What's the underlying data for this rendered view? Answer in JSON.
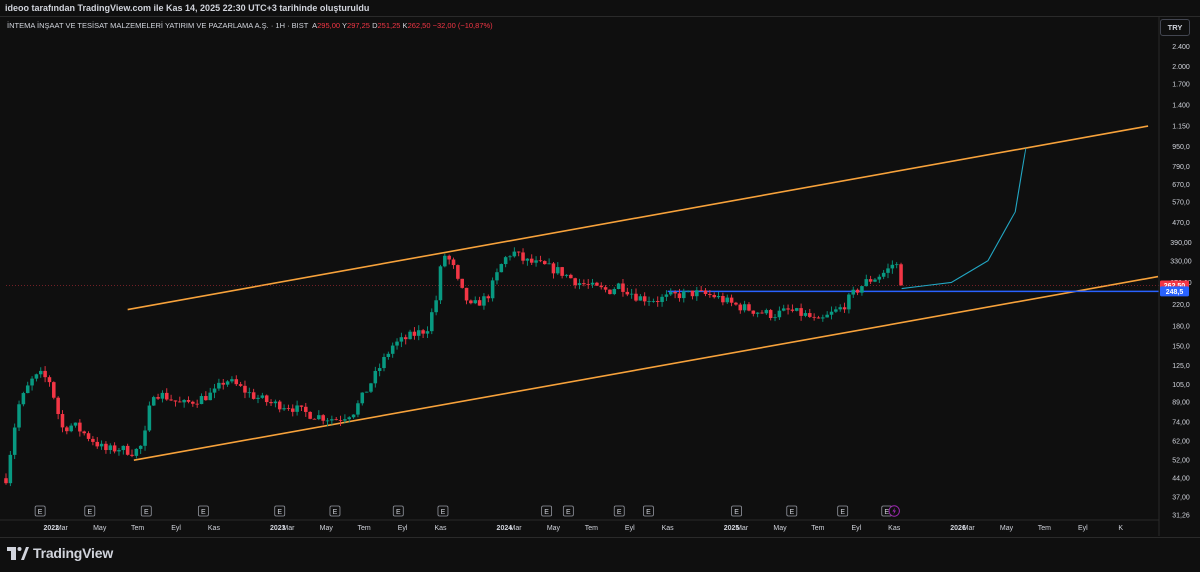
{
  "header": {
    "credit": "ideoo tarafından TradingView.com ile Kas 14, 2025 22:30 UTC+3 tarihinde oluşturuldu"
  },
  "legend": {
    "symbol": "İNTEMA İNŞAAT VE TESİSAT MALZEMELERİ YATIRIM VE PAZARLAMA A.Ş. · 1H · BIST",
    "open_label": "A",
    "open": "295,00",
    "high_label": "Y",
    "high": "297,25",
    "low_label": "D",
    "low": "251,25",
    "close_label": "K",
    "close": "262,50",
    "change": "−32,00 (−10,87%)"
  },
  "currency_button": "TRY",
  "footer": {
    "brand": "TradingView",
    "logo_icon": "tradingview-logo-icon"
  },
  "colors": {
    "background": "#0f0f0f",
    "up": "#089981",
    "down": "#f23645",
    "channel": "#f7a23b",
    "support": "#2962ff",
    "projection": "#22a7c4",
    "price_label": "#f23645",
    "support_label": "#2962ff",
    "lightning": "#9c27b0"
  },
  "chart_data": {
    "type": "candlestick",
    "title": "",
    "y_scale": "log",
    "y_range": [
      31,
      2600
    ],
    "x_range": [
      "2021-12-01",
      "2026-12-31"
    ],
    "y_tick_labels": [
      "2.400",
      "2.000",
      "1.700",
      "1.400",
      "1.150",
      "950,0",
      "790,0",
      "670,0",
      "570,0",
      "470,0",
      "390,00",
      "330,00",
      "270,00",
      "220,0",
      "180,0",
      "150,0",
      "125,0",
      "105,0",
      "89,00",
      "74,00",
      "62,00",
      "52,00",
      "44,00",
      "37,00",
      "31,26"
    ],
    "x_tick_labels": [
      {
        "label": "2022",
        "date": "2022-01-01",
        "bold": true
      },
      {
        "label": "Mar",
        "date": "2022-03-01"
      },
      {
        "label": "May",
        "date": "2022-05-01"
      },
      {
        "label": "Tem",
        "date": "2022-07-01"
      },
      {
        "label": "Eyl",
        "date": "2022-09-01"
      },
      {
        "label": "Kas",
        "date": "2022-11-01"
      },
      {
        "label": "2023",
        "date": "2023-01-01",
        "bold": true
      },
      {
        "label": "Mar",
        "date": "2023-03-01"
      },
      {
        "label": "May",
        "date": "2023-05-01"
      },
      {
        "label": "Tem",
        "date": "2023-07-01"
      },
      {
        "label": "Eyl",
        "date": "2023-09-01"
      },
      {
        "label": "Kas",
        "date": "2023-11-01"
      },
      {
        "label": "2024",
        "date": "2024-01-01",
        "bold": true
      },
      {
        "label": "Mar",
        "date": "2024-03-01"
      },
      {
        "label": "May",
        "date": "2024-05-01"
      },
      {
        "label": "Tem",
        "date": "2024-07-01"
      },
      {
        "label": "Eyl",
        "date": "2024-09-01"
      },
      {
        "label": "Kas",
        "date": "2024-11-01"
      },
      {
        "label": "2025",
        "date": "2025-01-01",
        "bold": true
      },
      {
        "label": "Mar",
        "date": "2025-03-01"
      },
      {
        "label": "May",
        "date": "2025-05-01"
      },
      {
        "label": "Tem",
        "date": "2025-07-01"
      },
      {
        "label": "Eyl",
        "date": "2025-09-01"
      },
      {
        "label": "Kas",
        "date": "2025-11-01"
      },
      {
        "label": "2026",
        "date": "2026-01-01",
        "bold": true
      },
      {
        "label": "Mar",
        "date": "2026-03-01"
      },
      {
        "label": "May",
        "date": "2026-05-01"
      },
      {
        "label": "Tem",
        "date": "2026-07-01"
      },
      {
        "label": "Eyl",
        "date": "2026-09-01"
      },
      {
        "label": "K",
        "date": "2026-11-01"
      }
    ],
    "price_path": [
      [
        "2021-12-01",
        44
      ],
      [
        "2021-12-20",
        85
      ],
      [
        "2022-01-10",
        108
      ],
      [
        "2022-01-25",
        115
      ],
      [
        "2022-02-10",
        108
      ],
      [
        "2022-03-01",
        70
      ],
      [
        "2022-03-20",
        72
      ],
      [
        "2022-04-15",
        64
      ],
      [
        "2022-05-10",
        57
      ],
      [
        "2022-06-01",
        58
      ],
      [
        "2022-06-25",
        56
      ],
      [
        "2022-07-10",
        60
      ],
      [
        "2022-07-25",
        98
      ],
      [
        "2022-08-15",
        94
      ],
      [
        "2022-09-10",
        87
      ],
      [
        "2022-10-10",
        92
      ],
      [
        "2022-11-01",
        97
      ],
      [
        "2022-11-20",
        110
      ],
      [
        "2022-12-10",
        103
      ],
      [
        "2023-01-01",
        95
      ],
      [
        "2023-02-01",
        88
      ],
      [
        "2023-03-01",
        86
      ],
      [
        "2023-04-01",
        80
      ],
      [
        "2023-05-01",
        77
      ],
      [
        "2023-05-20",
        76
      ],
      [
        "2023-06-15",
        82
      ],
      [
        "2023-07-15",
        110
      ],
      [
        "2023-08-15",
        150
      ],
      [
        "2023-09-15",
        165
      ],
      [
        "2023-10-10",
        175
      ],
      [
        "2023-10-25",
        230
      ],
      [
        "2023-11-05",
        355
      ],
      [
        "2023-11-20",
        320
      ],
      [
        "2023-12-01",
        260
      ],
      [
        "2023-12-20",
        215
      ],
      [
        "2024-01-15",
        235
      ],
      [
        "2024-02-10",
        330
      ],
      [
        "2024-02-25",
        360
      ],
      [
        "2024-03-15",
        330
      ],
      [
        "2024-04-15",
        315
      ],
      [
        "2024-05-10",
        300
      ],
      [
        "2024-06-10",
        270
      ],
      [
        "2024-07-10",
        255
      ],
      [
        "2024-07-30",
        250
      ],
      [
        "2024-08-15",
        265
      ],
      [
        "2024-09-15",
        235
      ],
      [
        "2024-10-15",
        230
      ],
      [
        "2024-11-15",
        240
      ],
      [
        "2024-12-15",
        245
      ],
      [
        "2025-01-15",
        238
      ],
      [
        "2025-02-15",
        220
      ],
      [
        "2025-03-20",
        208
      ],
      [
        "2025-04-20",
        200
      ],
      [
        "2025-05-15",
        208
      ],
      [
        "2025-06-15",
        198
      ],
      [
        "2025-07-01",
        185
      ],
      [
        "2025-07-20",
        200
      ],
      [
        "2025-08-10",
        215
      ],
      [
        "2025-08-25",
        240
      ],
      [
        "2025-09-15",
        270
      ],
      [
        "2025-10-05",
        285
      ],
      [
        "2025-10-20",
        300
      ],
      [
        "2025-11-03",
        330
      ],
      [
        "2025-11-13",
        262.5
      ]
    ],
    "channel_upper": [
      [
        "2022-06-15",
        210
      ],
      [
        "2026-12-15",
        1150
      ]
    ],
    "channel_lower": [
      [
        "2022-06-25",
        52
      ],
      [
        "2026-12-31",
        285
      ]
    ],
    "support_line": {
      "value": 248.5,
      "from": "2024-11-01",
      "to": "2026-12-31"
    },
    "projection_curve": [
      [
        "2025-11-13",
        255
      ],
      [
        "2026-02-01",
        270
      ],
      [
        "2026-04-01",
        330
      ],
      [
        "2026-05-15",
        520
      ],
      [
        "2026-06-01",
        940
      ]
    ],
    "price_label": "262,50",
    "price_label_value": 262.5,
    "support_label": "248,5",
    "earnings_markers": [
      "2022-01-25",
      "2022-04-15",
      "2022-07-15",
      "2022-10-15",
      "2023-02-15",
      "2023-05-15",
      "2023-08-25",
      "2023-11-05",
      "2024-04-20",
      "2024-05-25",
      "2024-08-15",
      "2024-10-01",
      "2025-02-20",
      "2025-05-20",
      "2025-08-10",
      "2025-10-20"
    ],
    "lightning_marker": "2025-11-01"
  }
}
